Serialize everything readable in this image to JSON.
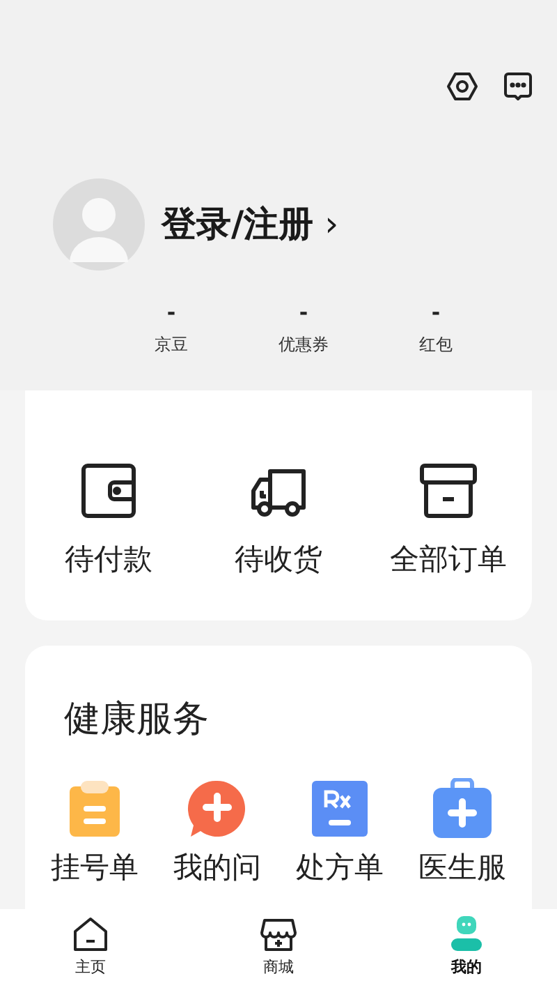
{
  "header": {
    "login_label": "登录/注册",
    "chevron": "›"
  },
  "stats": [
    {
      "value": "-",
      "label": "京豆"
    },
    {
      "value": "-",
      "label": "优惠券"
    },
    {
      "value": "-",
      "label": "红包"
    }
  ],
  "orders": [
    {
      "kind": "wallet",
      "label": "待付款"
    },
    {
      "kind": "truck",
      "label": "待收货"
    },
    {
      "kind": "box",
      "label": "全部订单"
    }
  ],
  "health": {
    "title": "健康服务",
    "items": [
      {
        "kind": "clipboard",
        "label": "挂号单"
      },
      {
        "kind": "chat",
        "label": "我的问"
      },
      {
        "kind": "rx",
        "label": "处方单"
      },
      {
        "kind": "kit",
        "label": "医生服"
      }
    ]
  },
  "nav": [
    {
      "kind": "home",
      "label": "主页",
      "selected": false
    },
    {
      "kind": "store",
      "label": "商城",
      "selected": false
    },
    {
      "kind": "me",
      "label": "我的",
      "selected": true
    }
  ]
}
